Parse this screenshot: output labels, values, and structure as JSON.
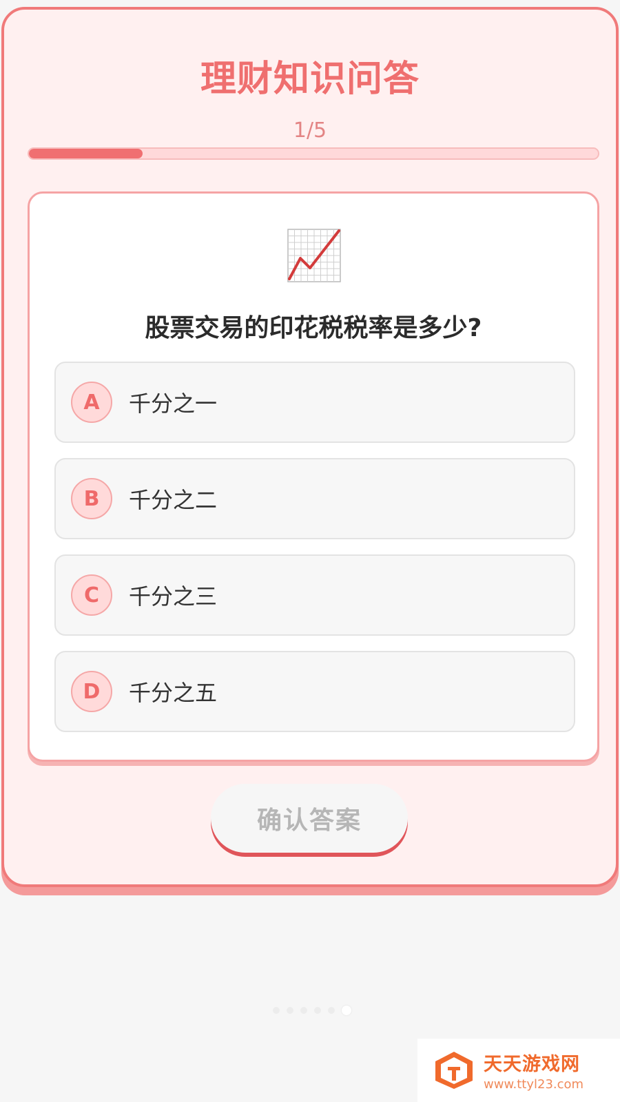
{
  "quiz": {
    "title": "理财知识问答",
    "progress_text": "1/5",
    "progress_fraction": 0.2,
    "icon": "chart-increasing-icon",
    "question": "股票交易的印花税税率是多少?",
    "options": [
      {
        "letter": "A",
        "text": "千分之一"
      },
      {
        "letter": "B",
        "text": "千分之二"
      },
      {
        "letter": "C",
        "text": "千分之三"
      },
      {
        "letter": "D",
        "text": "千分之五"
      }
    ],
    "confirm_label": "确认答案"
  },
  "watermark": {
    "name": "天天游戏网",
    "url": "www.ttyl23.com"
  },
  "colors": {
    "accent": "#f06f71",
    "card_bg": "#fff0f0",
    "option_bg": "#f7f7f7",
    "watermark": "#f06a2c"
  }
}
